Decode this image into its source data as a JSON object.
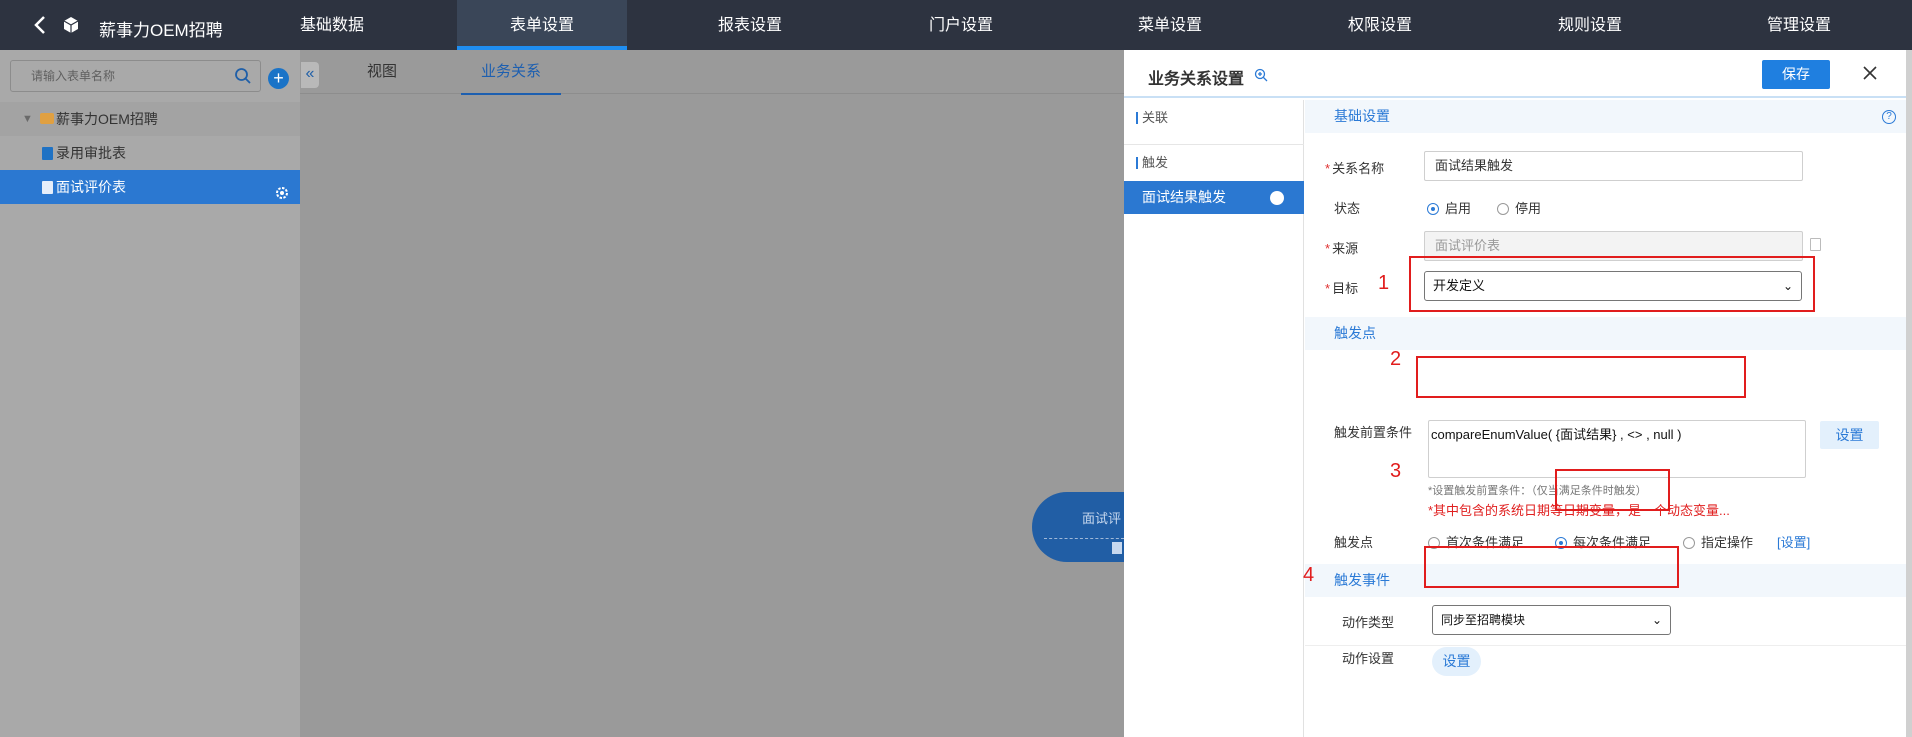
{
  "topbar": {
    "back_icon": "chevron-left-icon",
    "logo_icon": "cube-logo-icon",
    "app_title": "薪事力OEM招聘",
    "nav": [
      "基础数据",
      "表单设置",
      "报表设置",
      "门户设置",
      "菜单设置",
      "权限设置",
      "规则设置",
      "管理设置"
    ],
    "active_nav": "表单设置"
  },
  "sidebar": {
    "search_placeholder": "请输入表单名称",
    "add_icon": "plus-icon",
    "tree": {
      "folder": "薪事力OEM招聘",
      "items": [
        "录用审批表",
        "面试评价表"
      ],
      "selected": "面试评价表"
    }
  },
  "canvas": {
    "tabs": [
      "视图",
      "业务关系"
    ],
    "active_tab": "业务关系",
    "node_label": "面试评"
  },
  "panel": {
    "title": "业务关系设置",
    "save_label": "保存",
    "left_sections": [
      "关联",
      "触发"
    ],
    "trigger_item": "面试结果触发",
    "basic": {
      "header": "基础设置",
      "name_label": "关系名称",
      "name_value": "面试结果触发",
      "status_label": "状态",
      "status_options": [
        "启用",
        "停用"
      ],
      "status_selected": "启用",
      "source_label": "来源",
      "source_value": "面试评价表",
      "target_label": "目标",
      "target_value": "开发定义"
    },
    "trigger_point": {
      "header": "触发点",
      "pre_condition_label": "触发前置条件",
      "pre_condition_value": "compareEnumValue( {面试结果} , <> , null )",
      "set_label": "设置",
      "hint": "*设置触发前置条件：（仅当满足条件时触发）",
      "warning": "*其中包含的系统日期等日期变量，是一个动态变量...",
      "point_label": "触发点",
      "point_options": [
        "首次条件满足",
        "每次条件满足",
        "指定操作"
      ],
      "point_selected": "每次条件满足",
      "point_link": "[设置]"
    },
    "trigger_event": {
      "header": "触发事件",
      "action_type_label": "动作类型",
      "action_type_value": "同步至招聘模块",
      "action_setting_label": "动作设置",
      "action_setting_button": "设置"
    }
  },
  "annotations": [
    "1",
    "2",
    "3",
    "4"
  ],
  "colors": {
    "topbar": "#2d3340",
    "accent": "#2b78d1",
    "annotation": "#e11d1d"
  }
}
